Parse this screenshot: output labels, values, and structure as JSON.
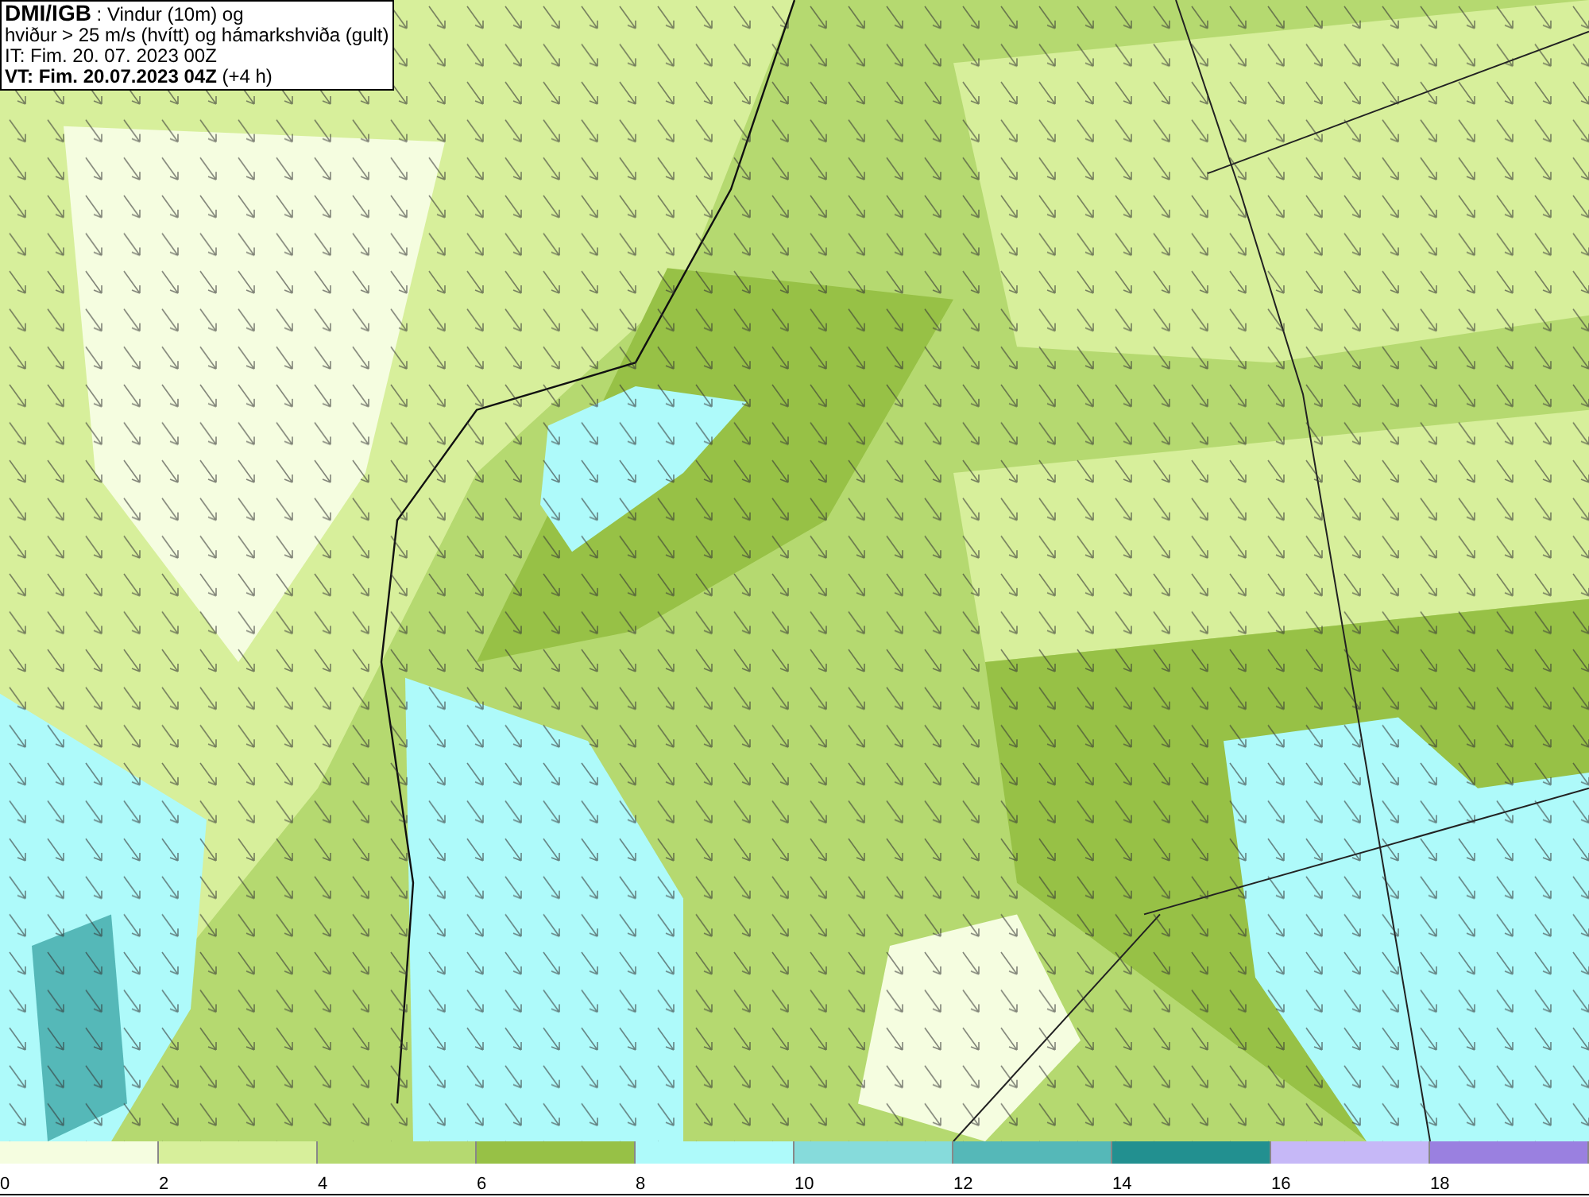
{
  "title_box": {
    "source": "DMI/IGB",
    "subject": " : Vindur (10m) og",
    "line2": "hviður > 25 m/s (hvítt) og hámarkshviða (gult)",
    "init_time": "IT: Fim. 20. 07. 2023 00Z",
    "valid_time": "VT: Fim. 20.07.2023 04Z",
    "valid_offset": " (+4 h)"
  },
  "legend": [
    {
      "label": "0",
      "color": "#f5fde0"
    },
    {
      "label": "2",
      "color": "#d7ef9b"
    },
    {
      "label": "4",
      "color": "#b5d970"
    },
    {
      "label": "6",
      "color": "#97c146"
    },
    {
      "label": "8",
      "color": "#aefafa"
    },
    {
      "label": "10",
      "color": "#86dbdb"
    },
    {
      "label": "12",
      "color": "#55b8b8"
    },
    {
      "label": "14",
      "color": "#229090"
    },
    {
      "label": "16",
      "color": "#c6b8f7"
    },
    {
      "label": "18",
      "color": "#9a80e0"
    }
  ]
}
